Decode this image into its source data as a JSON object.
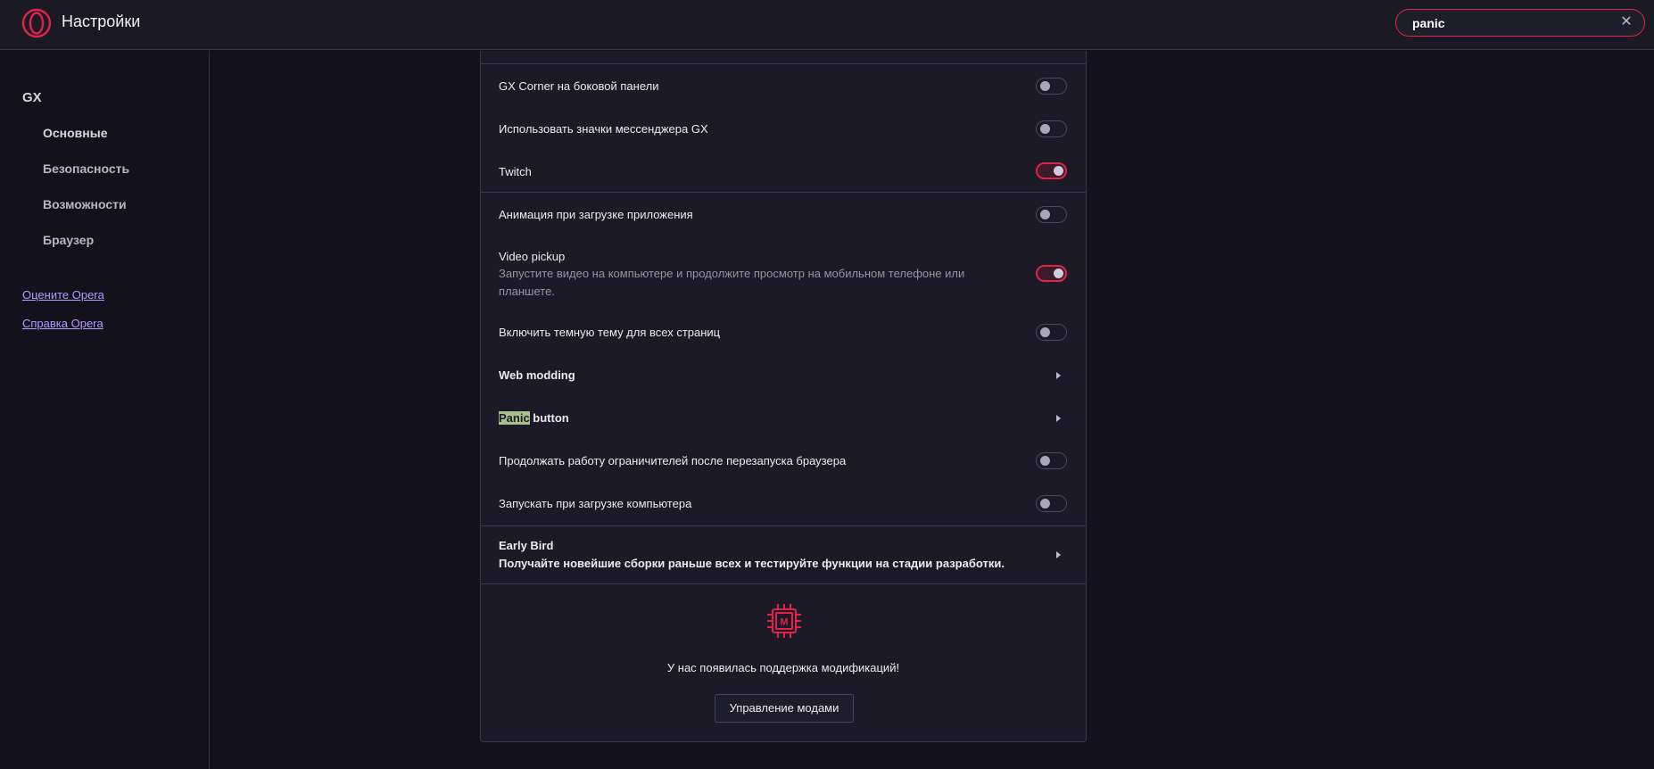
{
  "header": {
    "title": "Настройки",
    "search_value": "panic"
  },
  "colors": {
    "accent": "#e0234a",
    "link": "#b59bff",
    "background": "#13121c",
    "panel": "#1b1a26"
  },
  "sidebar": {
    "section": "GX",
    "items": [
      {
        "label": "Основные",
        "active": true
      },
      {
        "label": "Безопасность",
        "active": false
      },
      {
        "label": "Возможности",
        "active": false
      },
      {
        "label": "Браузер",
        "active": false
      }
    ],
    "links": [
      "Оцените Opera",
      "Справка Opera"
    ]
  },
  "settings": {
    "gx_corner": {
      "label": "GX Corner на боковой панели",
      "enabled": false
    },
    "messenger_icons": {
      "label": "Использовать значки мессенджера GX",
      "enabled": false
    },
    "twitch": {
      "label": "Twitch",
      "enabled": true
    },
    "startup_animation": {
      "label": "Анимация при загрузке приложения",
      "enabled": false
    },
    "video_pickup": {
      "label": "Video pickup",
      "description": "Запустите видео на компьютере и продолжите просмотр на мобильном телефоне или планшете.",
      "enabled": true
    },
    "dark_theme": {
      "label": "Включить темную тему для всех страниц",
      "enabled": false
    },
    "web_modding": {
      "label": "Web modding"
    },
    "panic_button": {
      "highlight": "Panic",
      "rest": " button"
    },
    "limiters_restart": {
      "label": "Продолжать работу ограничителей после перезапуска браузера",
      "enabled": false
    },
    "run_on_startup": {
      "label": "Запускать при загрузке компьютера",
      "enabled": false
    },
    "early_bird": {
      "label": "Early Bird",
      "description": "Получайте новейшие сборки раньше всех и тестируйте функции на стадии разработки."
    }
  },
  "mods": {
    "icon": "chip-mod-icon",
    "icon_letter": "M",
    "text": "У нас появилась поддержка модификаций!",
    "button_label": "Управление модами"
  }
}
